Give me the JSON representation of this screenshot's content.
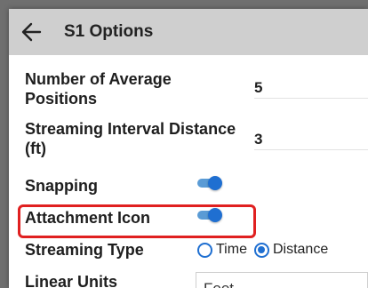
{
  "header": {
    "title": "S1 Options"
  },
  "settings": {
    "average_positions": {
      "label": "Number of Average Positions",
      "value": "5"
    },
    "streaming_interval": {
      "label": "Streaming Interval Distance (ft)",
      "value": "3"
    },
    "snapping": {
      "label": "Snapping",
      "enabled": true
    },
    "attachment_icon": {
      "label": "Attachment Icon",
      "enabled": true
    },
    "streaming_type": {
      "label": "Streaming Type",
      "options": [
        "Time",
        "Distance"
      ],
      "selected": "Distance"
    },
    "linear_units": {
      "label": "Linear Units",
      "value": "Feet"
    }
  },
  "colors": {
    "accent": "#1f6fd1",
    "highlight": "#e02020",
    "header_bg": "#cfcfcf"
  }
}
